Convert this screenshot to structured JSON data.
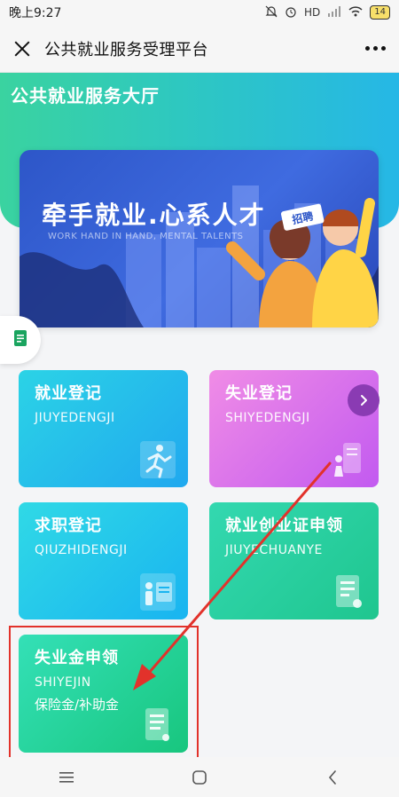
{
  "status": {
    "time": "晚上9:27",
    "network": "HD",
    "battery": "14"
  },
  "header": {
    "title": "公共就业服务受理平台"
  },
  "hero": {
    "title": "公共就业服务大厅"
  },
  "banner": {
    "title": "牵手就业.心系人才",
    "subtitle": "WORK HAND IN HAND, MENTAL TALENTS",
    "badge": "招聘"
  },
  "cards": [
    {
      "title": "就业登记",
      "subtitle": "JIUYEDENGJI",
      "extra": ""
    },
    {
      "title": "失业登记",
      "subtitle": "SHIYEDENGJI",
      "extra": ""
    },
    {
      "title": "求职登记",
      "subtitle": "QIUZHIDENGJI",
      "extra": ""
    },
    {
      "title": "就业创业证申领",
      "subtitle": "JIUYECHUANYE",
      "extra": ""
    },
    {
      "title": "失业金申领",
      "subtitle": "SHIYEJIN",
      "extra": "保险金/补助金"
    }
  ],
  "colors": {
    "hero_start": "#3ad3a0",
    "hero_end": "#26b7e6",
    "annotation": "#e2322b"
  },
  "icons": {
    "close": "close-icon",
    "more": "more-icon",
    "doc": "document-icon",
    "next": "chevron-right-icon"
  }
}
